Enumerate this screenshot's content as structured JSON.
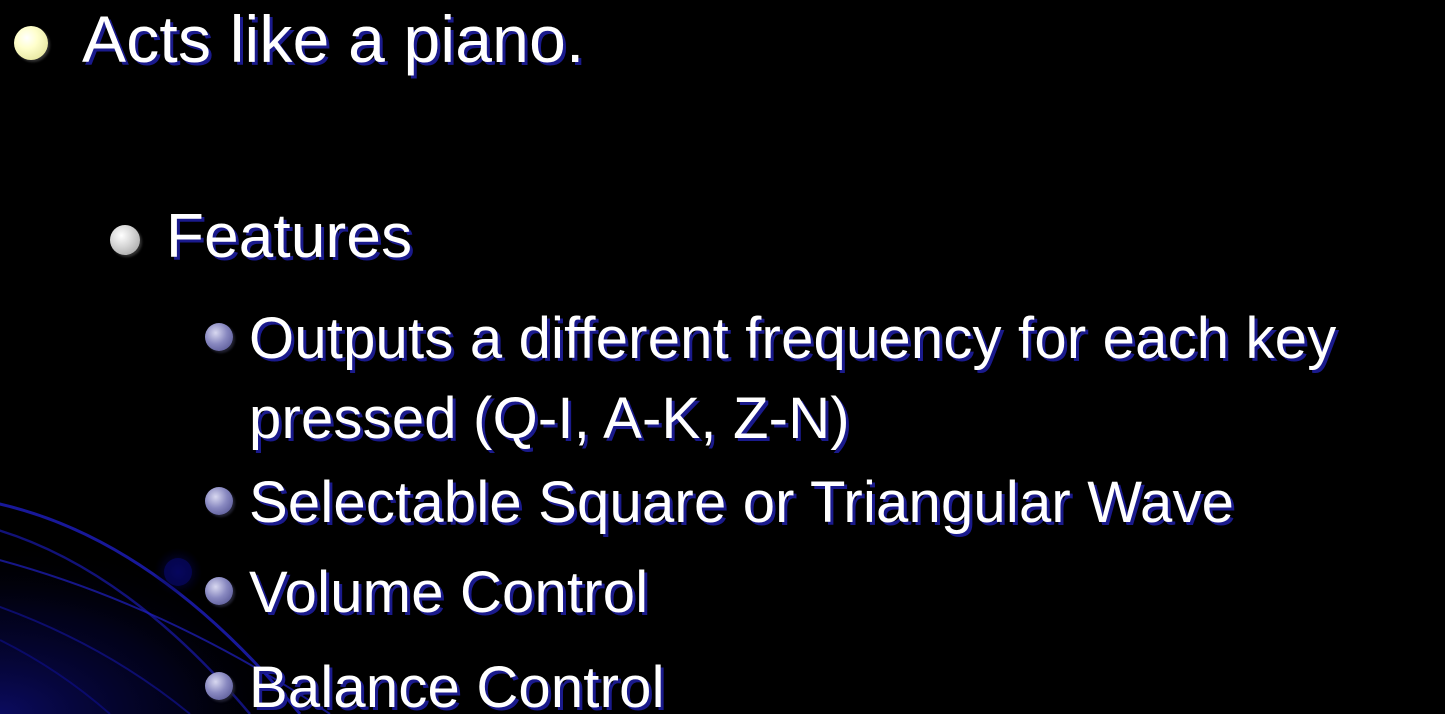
{
  "slide": {
    "bullet_level1": "Acts like a piano.",
    "bullet_level2": "Features",
    "sub_bullets": [
      "Outputs a different frequency for each key",
      "pressed (Q-I, A-K, Z-N)",
      "Selectable Square or Triangular Wave",
      "Volume Control",
      "Balance Control"
    ]
  },
  "colors": {
    "background": "#000000",
    "text": "#ffffff",
    "text_shadow": "#1a1a8c",
    "bullet_level1": "#ffffcc",
    "bullet_level2": "#c8c8c8",
    "bullet_level3": "#7070b0",
    "decor_curves": "#1c1cb4"
  },
  "icons": {
    "level1_bullet": "bullet-dot-icon",
    "level2_bullet": "bullet-dot-icon",
    "level3_bullet": "bullet-dot-icon"
  }
}
